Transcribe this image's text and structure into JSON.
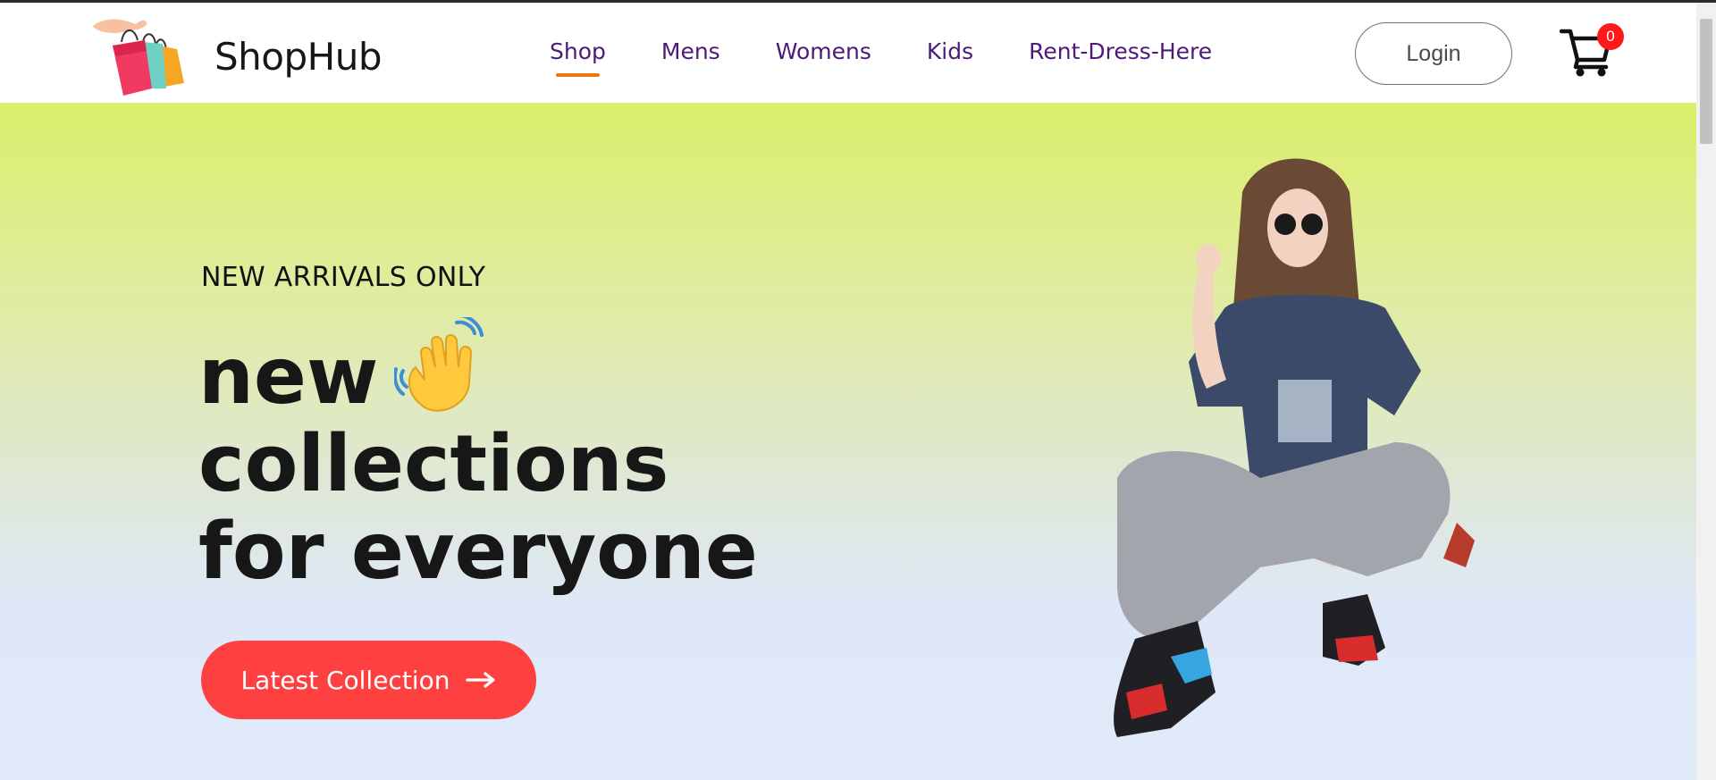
{
  "brand": {
    "name": "ShopHub",
    "logo_icon": "shopping-bags-icon"
  },
  "nav": {
    "items": [
      {
        "label": "Shop",
        "active": true
      },
      {
        "label": "Mens",
        "active": false
      },
      {
        "label": "Womens",
        "active": false
      },
      {
        "label": "Kids",
        "active": false
      },
      {
        "label": "Rent-Dress-Here",
        "active": false
      }
    ],
    "login_label": "Login",
    "cart_icon": "cart-icon",
    "cart_count": "0"
  },
  "hero": {
    "eyebrow": "NEW ARRIVALS ONLY",
    "headline_line1": "new",
    "headline_line2": "collections",
    "headline_line3": "for everyone",
    "cta_label": "Latest Collection",
    "cta_icon": "arrow-right-icon",
    "wave_icon": "waving-hand-icon"
  },
  "colors": {
    "accent": "#ff4040",
    "nav_text": "#4c1a78",
    "nav_underline": "#e8780f",
    "badge": "#ff1a1a",
    "hero_top": "#dbef6a",
    "hero_bottom": "#e0eaf9"
  }
}
